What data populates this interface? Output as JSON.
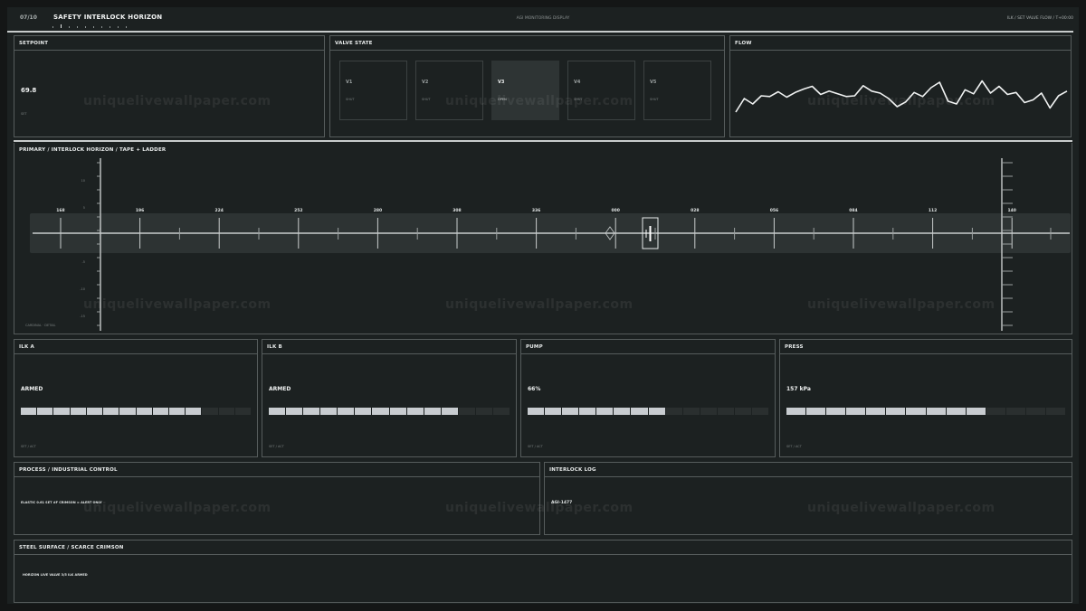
{
  "topbar": {
    "counter": "07/10",
    "title": "SAFETY INTERLOCK HORIZON",
    "center": "AGI MONITORING DISPLAY",
    "right": "ILK  /  SET VALVE FLOW  /  T+00:00",
    "dot_count": 10,
    "active_dot": 1
  },
  "setpoint": {
    "title": "SETPOINT",
    "value": "69.8",
    "sub": "SET"
  },
  "valve_state": {
    "title": "VALVE STATE",
    "valves": [
      {
        "name": "V1",
        "state": "SHUT"
      },
      {
        "name": "V2",
        "state": "SHUT"
      },
      {
        "name": "V3",
        "state": "OPEN",
        "active": true
      },
      {
        "name": "V4",
        "state": "SHUT"
      },
      {
        "name": "V5",
        "state": "SHUT"
      }
    ]
  },
  "flow": {
    "title": "FLOW",
    "series": [
      24,
      44,
      36,
      48,
      47,
      54,
      46,
      53,
      58,
      62,
      50,
      55,
      51,
      47,
      48,
      63,
      55,
      52,
      44,
      32,
      39,
      53,
      47,
      60,
      68,
      40,
      36,
      57,
      51,
      70,
      52,
      62,
      50,
      53,
      38,
      42,
      52,
      30,
      48,
      55
    ],
    "range": [
      0,
      100
    ]
  },
  "primary": {
    "title": "PRIMARY  /  INTERLOCK HORIZON  /  TAPE + LADDER",
    "tape_labels": [
      "168",
      "196",
      "224",
      "252",
      "280",
      "308",
      "336",
      "000",
      "028",
      "056",
      "084",
      "112",
      "140"
    ],
    "ladder_left": [
      "10",
      "5",
      "",
      "-5",
      "-10",
      "-15"
    ],
    "footer": "CARDINAL · DETAIL"
  },
  "ilk_a": {
    "title": "ILK A",
    "value": "ARMED",
    "level": 0.75,
    "segments": 14,
    "on": 11,
    "sub": "SET / ACT"
  },
  "ilk_b": {
    "title": "ILK B",
    "value": "ARMED",
    "level": 0.78,
    "segments": 14,
    "on": 11,
    "sub": "SET / ACT"
  },
  "pump": {
    "title": "PUMP",
    "value": "66%",
    "level": 0.66,
    "segments": 14,
    "on": 8,
    "sub": "SET / ACT"
  },
  "press": {
    "title": "PRESS",
    "value": "157 kPa",
    "level": 0.7,
    "segments": 14,
    "on": 10,
    "sub": "SET / ACT"
  },
  "process": {
    "title": "PROCESS  /  INDUSTRIAL CONTROL",
    "line": "ELASTIC 0.61   SET #F   CRIMSON = ALERT ONLY"
  },
  "interlock_log": {
    "title": "INTERLOCK LOG",
    "line": "AGI-1477"
  },
  "steel": {
    "title": "STEEL SURFACE  /  SCARCE CRIMSON",
    "line": "HORIZON LIVE   VALVE 3/5   ILK ARMED"
  },
  "watermark": "uniquelivewallpaper.com",
  "colors": {
    "background": "#1c2121",
    "border": "#565c5c",
    "accent": "#c8ccd0"
  }
}
